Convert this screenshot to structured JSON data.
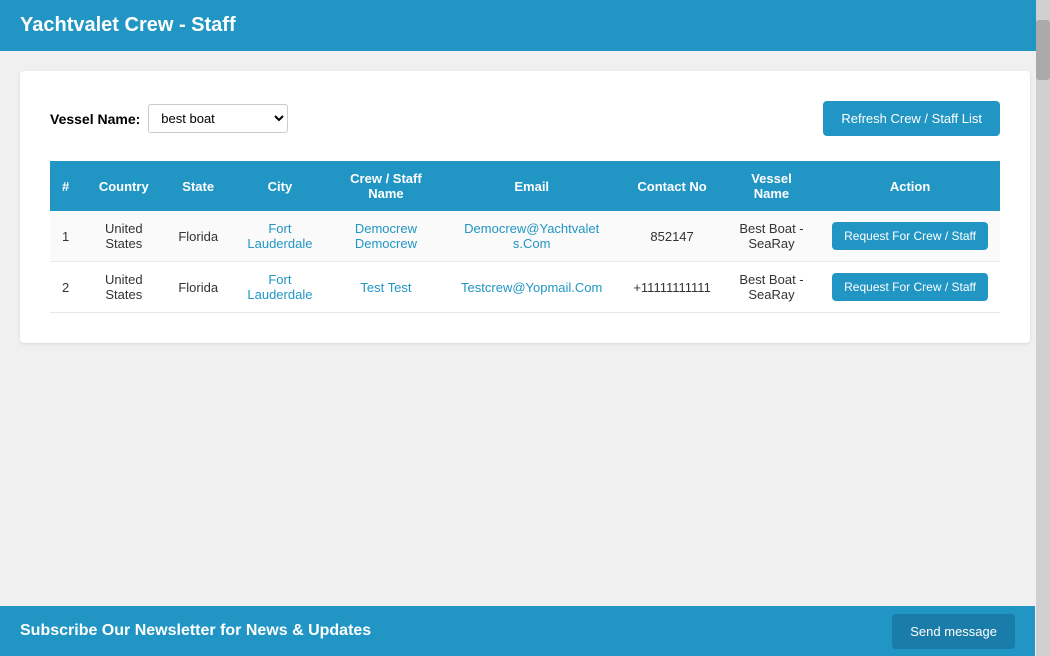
{
  "header": {
    "title": "Yachtvalet Crew - Staff"
  },
  "vessel_selector": {
    "label": "Vessel Name:",
    "selected_value": "best boat",
    "options": [
      "best boat"
    ]
  },
  "refresh_button": {
    "label": "Refresh Crew / Staff List"
  },
  "table": {
    "columns": [
      "#",
      "Country",
      "State",
      "City",
      "Crew / Staff Name",
      "Email",
      "Contact No",
      "Vessel Name",
      "Action"
    ],
    "rows": [
      {
        "num": "1",
        "country": "United States",
        "state": "Florida",
        "city": "Fort Lauderdale",
        "crew_name": "Democrew Democrew",
        "email": "Democrew@Yachtvalet s.Com",
        "contact_no": "852147",
        "vessel_name": "Best Boat - SeaRay",
        "action_label": "Request For Crew / Staff"
      },
      {
        "num": "2",
        "country": "United States",
        "state": "Florida",
        "city": "Fort Lauderdale",
        "crew_name": "Test Test",
        "email": "Testcrew@Yopmail.Com",
        "contact_no": "+11111111111",
        "vessel_name": "Best Boat - SeaRay",
        "action_label": "Request For Crew / Staff"
      }
    ]
  },
  "footer": {
    "subscribe_text": "Subscribe Our Newsletter for News & Updates",
    "send_message_label": "Send message"
  }
}
